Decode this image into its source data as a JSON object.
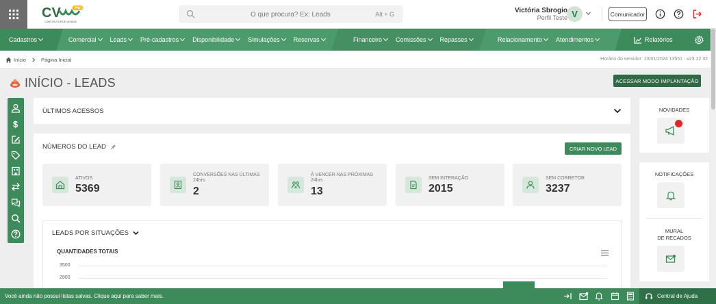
{
  "header": {
    "search_placeholder": "O que procura? Ex: Leads",
    "search_shortcut": "Alt + G",
    "user_name": "Victória Sbrogio",
    "user_profile": "Perfil Teste",
    "avatar_initial": "V",
    "communicator_label": "Comunicador",
    "logo_text": "CV",
    "logo_tag": "PRO",
    "logo_sub": "CONSTRUTOR DE VENDAS"
  },
  "nav": {
    "items": [
      "Cadastros",
      "Comercial",
      "Leads",
      "Pré-cadastros",
      "Disponibilidade",
      "Simulações",
      "Reservas",
      "Financeiro",
      "Comissões",
      "Repasses",
      "Relacionamento",
      "Atendimentos"
    ],
    "reports_label": "Relatórios"
  },
  "breadcrumb": {
    "home": "Início",
    "current": "Página Inicial",
    "server_time": "Horário do servidor: 10/01/2024 13h51 · v23.12.32"
  },
  "page": {
    "title": "INÍCIO - LEADS",
    "implant_button": "ACESSAR MODO IMPLANTAÇÃO"
  },
  "recent": {
    "title": "ÚLTIMOS ACESSOS"
  },
  "numbers": {
    "title": "NÚMEROS DO LEAD",
    "new_lead_button": "CRIAR NOVO LEAD",
    "stats": [
      {
        "label": "ATIVOS",
        "value": "5369"
      },
      {
        "label": "CONVERSÕES NAS ÚLTIMAS 24hrs",
        "value": "2"
      },
      {
        "label": "À VENCER NAS PRÓXIMAS 24hrs",
        "value": "13"
      },
      {
        "label": "SEM INTERAÇÃO",
        "value": "2015"
      },
      {
        "label": "SEM CORRETOR",
        "value": "3237"
      }
    ]
  },
  "chart_section": {
    "title": "LEADS POR SITUAÇÕES",
    "subtitle": "QUANTIDADES TOTAIS"
  },
  "chart_data": {
    "type": "bar",
    "title": "QUANTIDADES TOTAIS",
    "y_ticks": [
      "3500",
      "2800"
    ],
    "ylim": [
      2800,
      3500
    ]
  },
  "right_panel": {
    "news": "NOVIDADES",
    "notifications": "NOTIFICAÇÕES",
    "mural_line1": "MURAL",
    "mural_line2": "DE RECADOS"
  },
  "footer": {
    "message": "Você ainda não possui listas salvas. Clique aqui para saber mais.",
    "help_label": "Central de Ajuda"
  },
  "colors": {
    "primary": "#3d8a5b",
    "nav": "#4d9b6c",
    "dark": "#2e6a45",
    "alert": "#d62b2b"
  }
}
